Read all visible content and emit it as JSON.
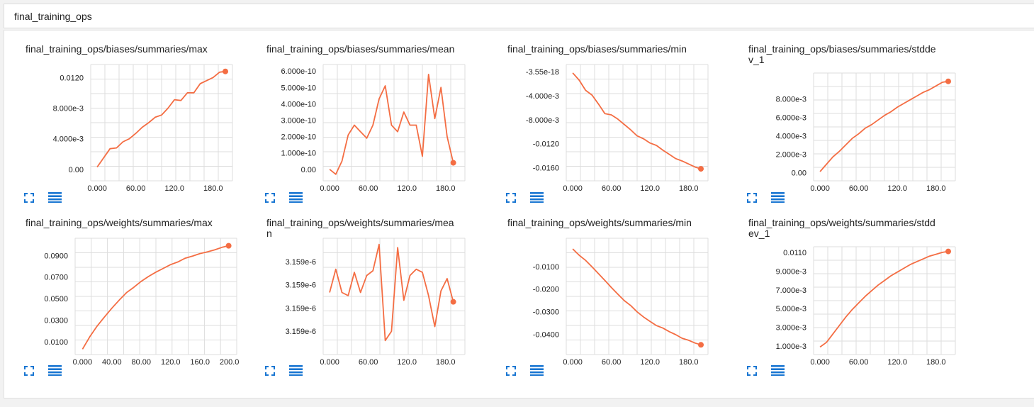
{
  "header": {
    "title": "final_training_ops"
  },
  "colors": {
    "series": "#f46d43",
    "grid": "#dddddd",
    "icon": "#1976d2"
  },
  "icons": {
    "expand": "fullscreen-icon",
    "toggle": "list-icon"
  },
  "cards": [
    {
      "title": "final_training_ops/biases/summaries/max",
      "chart_data": {
        "type": "line",
        "x": [
          0,
          10,
          20,
          30,
          40,
          50,
          60,
          70,
          80,
          90,
          100,
          110,
          120,
          130,
          140,
          150,
          160,
          170,
          180,
          190,
          199
        ],
        "y": [
          0.0003,
          0.0015,
          0.0027,
          0.0028,
          0.0036,
          0.004,
          0.0047,
          0.0055,
          0.0061,
          0.0068,
          0.0071,
          0.008,
          0.0091,
          0.009,
          0.01,
          0.01,
          0.0112,
          0.0116,
          0.012,
          0.0127,
          0.0128
        ],
        "xlim": [
          -10,
          210
        ],
        "ylim": [
          -0.0015,
          0.0137
        ],
        "xticks": [
          0,
          60,
          120,
          180
        ],
        "xtick_labels": [
          "0.000",
          "60.00",
          "120.0",
          "180.0"
        ],
        "yticks": [
          0,
          0.004,
          0.008,
          0.012
        ],
        "ytick_labels": [
          "0.00",
          "4.000e-3",
          "8.000e-3",
          "0.0120"
        ],
        "title": "",
        "xlabel": "",
        "ylabel": "",
        "grid": true
      }
    },
    {
      "title": "final_training_ops/biases/summaries/mean",
      "chart_data": {
        "type": "line",
        "x": [
          0,
          8,
          16,
          24,
          32,
          40,
          48,
          56,
          64,
          72,
          80,
          88,
          96,
          104,
          112,
          120,
          128,
          136,
          144,
          152,
          160,
          168,
          176,
          184,
          192
        ],
        "y": [
          0,
          -3e-11,
          5e-11,
          2.1e-10,
          2.7e-10,
          2.3e-10,
          1.9e-10,
          2.7e-10,
          4.3e-10,
          5.1e-10,
          2.7e-10,
          2.3e-10,
          3.5e-10,
          2.7e-10,
          2.7e-10,
          8e-11,
          5.8e-10,
          3.1e-10,
          5e-10,
          2e-10,
          4e-11
        ],
        "xlim": [
          -10,
          210
        ],
        "ylim": [
          -7e-11,
          6.4e-10
        ],
        "xticks": [
          0,
          60,
          120,
          180
        ],
        "xtick_labels": [
          "0.000",
          "60.00",
          "120.0",
          "180.0"
        ],
        "yticks": [
          0,
          1e-10,
          2e-10,
          3e-10,
          4e-10,
          5e-10,
          6e-10
        ],
        "ytick_labels": [
          "0.00",
          "1.000e-10",
          "2.000e-10",
          "3.000e-10",
          "4.000e-10",
          "5.000e-10",
          "6.000e-10"
        ],
        "title": "",
        "xlabel": "",
        "ylabel": "",
        "grid": true
      }
    },
    {
      "title": "final_training_ops/biases/summaries/min",
      "chart_data": {
        "type": "line",
        "x": [
          0,
          10,
          20,
          30,
          40,
          50,
          60,
          70,
          80,
          90,
          100,
          110,
          120,
          130,
          140,
          150,
          160,
          170,
          180,
          190,
          199
        ],
        "y": [
          -0.0002,
          -0.0014,
          -0.0031,
          -0.0039,
          -0.0054,
          -0.007,
          -0.0072,
          -0.0079,
          -0.0088,
          -0.0097,
          -0.0107,
          -0.0112,
          -0.0119,
          -0.0123,
          -0.0131,
          -0.0138,
          -0.0145,
          -0.0149,
          -0.0154,
          -0.0159,
          -0.0162
        ],
        "xlim": [
          -10,
          210
        ],
        "ylim": [
          -0.0182,
          0.0012
        ],
        "xticks": [
          0,
          60,
          120,
          180
        ],
        "xtick_labels": [
          "0.000",
          "60.00",
          "120.0",
          "180.0"
        ],
        "yticks": [
          0,
          -0.004,
          -0.008,
          -0.012,
          -0.016
        ],
        "ytick_labels": [
          "-3.55e-18",
          "-4.000e-3",
          "-8.000e-3",
          "-0.0120",
          "-0.0160"
        ],
        "title": "",
        "xlabel": "",
        "ylabel": "",
        "grid": true
      }
    },
    {
      "title": "final_training_ops/biases/summaries/stddev_1",
      "chart_data": {
        "type": "line",
        "x": [
          0,
          10,
          20,
          30,
          40,
          50,
          60,
          70,
          80,
          90,
          100,
          110,
          120,
          130,
          140,
          150,
          160,
          170,
          180,
          190,
          199
        ],
        "y": [
          0.0001,
          0.0009,
          0.0017,
          0.0023,
          0.003,
          0.0037,
          0.0042,
          0.0048,
          0.0052,
          0.0057,
          0.0062,
          0.0066,
          0.0071,
          0.0075,
          0.0079,
          0.0083,
          0.0087,
          0.009,
          0.0094,
          0.0098,
          0.0099
        ],
        "xlim": [
          -10,
          210
        ],
        "ylim": [
          -0.0009,
          0.0108
        ],
        "xticks": [
          0,
          60,
          120,
          180
        ],
        "xtick_labels": [
          "0.000",
          "60.00",
          "120.0",
          "180.0"
        ],
        "yticks": [
          0,
          0.002,
          0.004,
          0.006,
          0.008
        ],
        "ytick_labels": [
          "0.00",
          "2.000e-3",
          "4.000e-3",
          "6.000e-3",
          "8.000e-3"
        ],
        "title": "",
        "xlabel": "",
        "ylabel": "",
        "grid": true
      }
    },
    {
      "title": "final_training_ops/weights/summaries/max",
      "chart_data": {
        "type": "line",
        "x": [
          0,
          10,
          20,
          30,
          40,
          50,
          60,
          70,
          80,
          90,
          100,
          110,
          120,
          130,
          140,
          150,
          160,
          170,
          180,
          190,
          199
        ],
        "y": [
          0.003,
          0.0145,
          0.0245,
          0.033,
          0.041,
          0.0485,
          0.0555,
          0.0605,
          0.066,
          0.0705,
          0.0745,
          0.078,
          0.0815,
          0.084,
          0.0875,
          0.0895,
          0.0918,
          0.0933,
          0.0952,
          0.0976,
          0.099
        ],
        "xlim": [
          -10,
          210
        ],
        "ylim": [
          -0.002,
          0.106
        ],
        "xticks": [
          0,
          40,
          80,
          120,
          160,
          200
        ],
        "xtick_labels": [
          "0.000",
          "40.00",
          "80.00",
          "120.0",
          "160.0",
          "200.0"
        ],
        "yticks": [
          0.01,
          0.03,
          0.05,
          0.07,
          0.09
        ],
        "ytick_labels": [
          "0.0100",
          "0.0300",
          "0.0500",
          "0.0700",
          "0.0900"
        ],
        "title": "",
        "xlabel": "",
        "ylabel": "",
        "grid": true
      }
    },
    {
      "title": "final_training_ops/weights/summaries/mean",
      "chart_data": {
        "type": "line",
        "x": [
          0,
          8,
          16,
          24,
          32,
          40,
          48,
          56,
          64,
          72,
          80,
          88,
          96,
          104,
          112,
          120,
          128,
          136,
          144,
          152,
          160,
          168,
          176,
          184,
          192
        ],
        "y": [
          2.0,
          5.0,
          2.0,
          1.6,
          4.6,
          2.0,
          4.2,
          4.8,
          8.2,
          -4.2,
          -3.0,
          7.8,
          1.0,
          4.2,
          5.0,
          4.6,
          1.6,
          -2.4,
          2.2,
          3.8,
          0.8
        ],
        "xlim": [
          -10,
          210
        ],
        "ylim": [
          -6,
          9
        ],
        "xticks": [
          0,
          60,
          120,
          180
        ],
        "xtick_labels": [
          "0.000",
          "60.00",
          "120.0",
          "180.0"
        ],
        "yticks": [
          6,
          3,
          0,
          -3
        ],
        "ytick_labels": [
          "3.159e-6",
          "3.159e-6",
          "3.159e-6",
          "3.159e-6"
        ],
        "title": "",
        "xlabel": "",
        "ylabel": "",
        "grid": true
      }
    },
    {
      "title": "final_training_ops/weights/summaries/min",
      "chart_data": {
        "type": "line",
        "x": [
          0,
          10,
          20,
          30,
          40,
          50,
          60,
          70,
          80,
          90,
          100,
          110,
          120,
          130,
          140,
          150,
          160,
          170,
          180,
          190,
          199
        ],
        "y": [
          -0.0022,
          -0.005,
          -0.0073,
          -0.0102,
          -0.0132,
          -0.0162,
          -0.0193,
          -0.0222,
          -0.0251,
          -0.0273,
          -0.0301,
          -0.0324,
          -0.0343,
          -0.0362,
          -0.0373,
          -0.0389,
          -0.0402,
          -0.0418,
          -0.0427,
          -0.0439,
          -0.0447
        ],
        "xlim": [
          -10,
          210
        ],
        "ylim": [
          -0.049,
          0.0025
        ],
        "xticks": [
          0,
          60,
          120,
          180
        ],
        "xtick_labels": [
          "0.000",
          "60.00",
          "120.0",
          "180.0"
        ],
        "yticks": [
          -0.01,
          -0.02,
          -0.03,
          -0.04
        ],
        "ytick_labels": [
          "-0.0100",
          "-0.0200",
          "-0.0300",
          "-0.0400"
        ],
        "title": "",
        "xlabel": "",
        "ylabel": "",
        "grid": true
      }
    },
    {
      "title": "final_training_ops/weights/summaries/stddev_1",
      "chart_data": {
        "type": "line",
        "x": [
          0,
          10,
          20,
          30,
          40,
          50,
          60,
          70,
          80,
          90,
          100,
          110,
          120,
          130,
          140,
          150,
          160,
          170,
          180,
          190,
          199
        ],
        "y": [
          0.0009,
          0.0014,
          0.0023,
          0.0032,
          0.0041,
          0.0049,
          0.0056,
          0.0063,
          0.0069,
          0.0075,
          0.008,
          0.0085,
          0.0089,
          0.0093,
          0.0097,
          0.01,
          0.0103,
          0.0106,
          0.0108,
          0.011,
          0.0111
        ],
        "xlim": [
          -10,
          210
        ],
        "ylim": [
          0.0001,
          0.0116
        ],
        "xticks": [
          0,
          60,
          120,
          180
        ],
        "xtick_labels": [
          "0.000",
          "60.00",
          "120.0",
          "180.0"
        ],
        "yticks": [
          0.001,
          0.003,
          0.005,
          0.007,
          0.009,
          0.011
        ],
        "ytick_labels": [
          "1.000e-3",
          "3.000e-3",
          "5.000e-3",
          "7.000e-3",
          "9.000e-3",
          "0.0110"
        ],
        "title": "",
        "xlabel": "",
        "ylabel": "",
        "grid": true
      }
    }
  ]
}
